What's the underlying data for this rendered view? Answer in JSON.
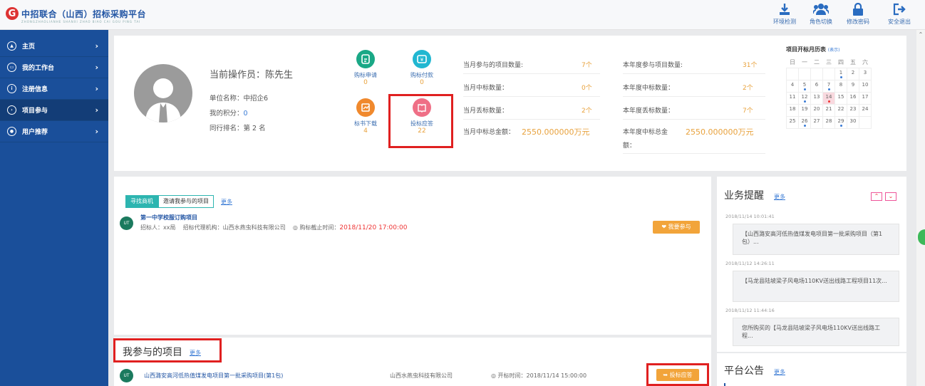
{
  "header": {
    "logo_letter": "G",
    "logo_text": "中招联合（山西）招标采购平台",
    "logo_sub": "ZHONGZHAOLIANHE  SHANXI  ZHAO BIAO CAI GOU PING TAI",
    "buttons": [
      {
        "label": "环境检测",
        "icon": "download-icon"
      },
      {
        "label": "角色切换",
        "icon": "users-icon"
      },
      {
        "label": "修改密码",
        "icon": "lock-icon"
      },
      {
        "label": "安全退出",
        "icon": "logout-icon"
      }
    ],
    "brand_color": "#1a4f9a"
  },
  "sidebar": {
    "items": [
      {
        "label": "主页",
        "icon": "home-icon"
      },
      {
        "label": "我的工作台",
        "icon": "workbench-icon"
      },
      {
        "label": "注册信息",
        "icon": "info-icon"
      },
      {
        "label": "项目参与",
        "icon": "project-icon",
        "active": true
      },
      {
        "label": "用户推荐",
        "icon": "user-icon"
      }
    ],
    "chevron": "›"
  },
  "profile": {
    "operator_label": "当前操作员：",
    "operator_name": "陈先生",
    "unit": "单位名称：中招企6",
    "points_label": "我的积分：",
    "points": "0",
    "rank_label": "同行排名：第 ",
    "rank": "2",
    "rank_suffix": " 名"
  },
  "quick": [
    {
      "label": "购标申请",
      "count": "0",
      "color": "#1aa886",
      "icon": "apply-icon"
    },
    {
      "label": "购标付款",
      "count": "0",
      "color": "#21b7d1",
      "icon": "payment-icon"
    },
    {
      "label": "标书下载",
      "count": "4",
      "color": "#f0892d",
      "icon": "download-doc-icon"
    },
    {
      "label": "投标应答",
      "count": "22",
      "color": "#ef6f86",
      "icon": "bid-response-icon"
    }
  ],
  "stats_month": [
    {
      "label": "当月参与的项目数量:",
      "value": "7个"
    },
    {
      "label": "当月中标数量：",
      "value": "0个"
    },
    {
      "label": "当月丢标数量：",
      "value": "2个"
    },
    {
      "label": "当月中标总金额：",
      "value": "2550.000000万元"
    }
  ],
  "stats_year": [
    {
      "label": "本年度参与项目数量:",
      "value": "31个"
    },
    {
      "label": "本年度中标数量：",
      "value": "2个"
    },
    {
      "label": "本年度丢标数量：",
      "value": "7个"
    },
    {
      "label": "本年度中标总金",
      "label2": "额：",
      "value": "2550.000000万元"
    }
  ],
  "calendar": {
    "title": "项目开标月历表",
    "note": "(表示)",
    "weekdays": [
      "日",
      "一",
      "二",
      "三",
      "四",
      "五",
      "六"
    ],
    "weeks": [
      [
        "",
        "",
        "",
        "",
        "1",
        "2",
        "3"
      ],
      [
        "4",
        "5",
        "6",
        "7",
        "8",
        "9",
        "10"
      ],
      [
        "11",
        "12",
        "13",
        "14",
        "15",
        "16",
        "17"
      ],
      [
        "18",
        "19",
        "20",
        "21",
        "22",
        "23",
        "24"
      ],
      [
        "25",
        "26",
        "27",
        "28",
        "29",
        "30",
        ""
      ]
    ],
    "today": "14",
    "blue_dots": [
      "1",
      "5",
      "7",
      "12",
      "26",
      "29"
    ],
    "red_dots": [
      "14"
    ]
  },
  "opportunity": {
    "tabs": [
      "寻找商机",
      "邀请我参与的项目"
    ],
    "more": "更多",
    "item": {
      "icon_text": "UT",
      "title": "第一中学校服订购项目",
      "tenderer": "招标人：xx局",
      "agency": "招标代理机构：山西水燕虫科技有限公司",
      "deadline_label": "◎ 购标截止时间：",
      "deadline": "2018/11/20 17:00:00",
      "join_button": "❤ 我要参与"
    }
  },
  "my_projects": {
    "title": "我参与的项目",
    "more": "更多",
    "item": {
      "icon_text": "UT",
      "title": "山西潞安高河低热值煤发电项目第一批采购项目(第1包)",
      "company": "山西水燕虫科技有限公司",
      "open_time": "◎ 开标时间：2018/11/14 15:00:00",
      "button": "➥ 投标应答"
    }
  },
  "reminders": {
    "title": "业务提醒",
    "more": "更多",
    "up": "⌃",
    "down": "⌄",
    "items": [
      {
        "time": "2018/11/14 10:01:41",
        "text": "【山西潞安高河低热值煤发电项目第一批采购项目（第1包）..."
      },
      {
        "time": "2018/11/12 14:26:11",
        "text": "【马龙县陆坡梁子风电场110KV送出线路工程项目11次..."
      },
      {
        "time": "2018/11/12 11:44:16",
        "text": "您所购买的【马龙县陆坡梁子风电场110KV送出线路工程..."
      }
    ]
  },
  "announcements": {
    "title": "平台公告",
    "more": "更多"
  }
}
